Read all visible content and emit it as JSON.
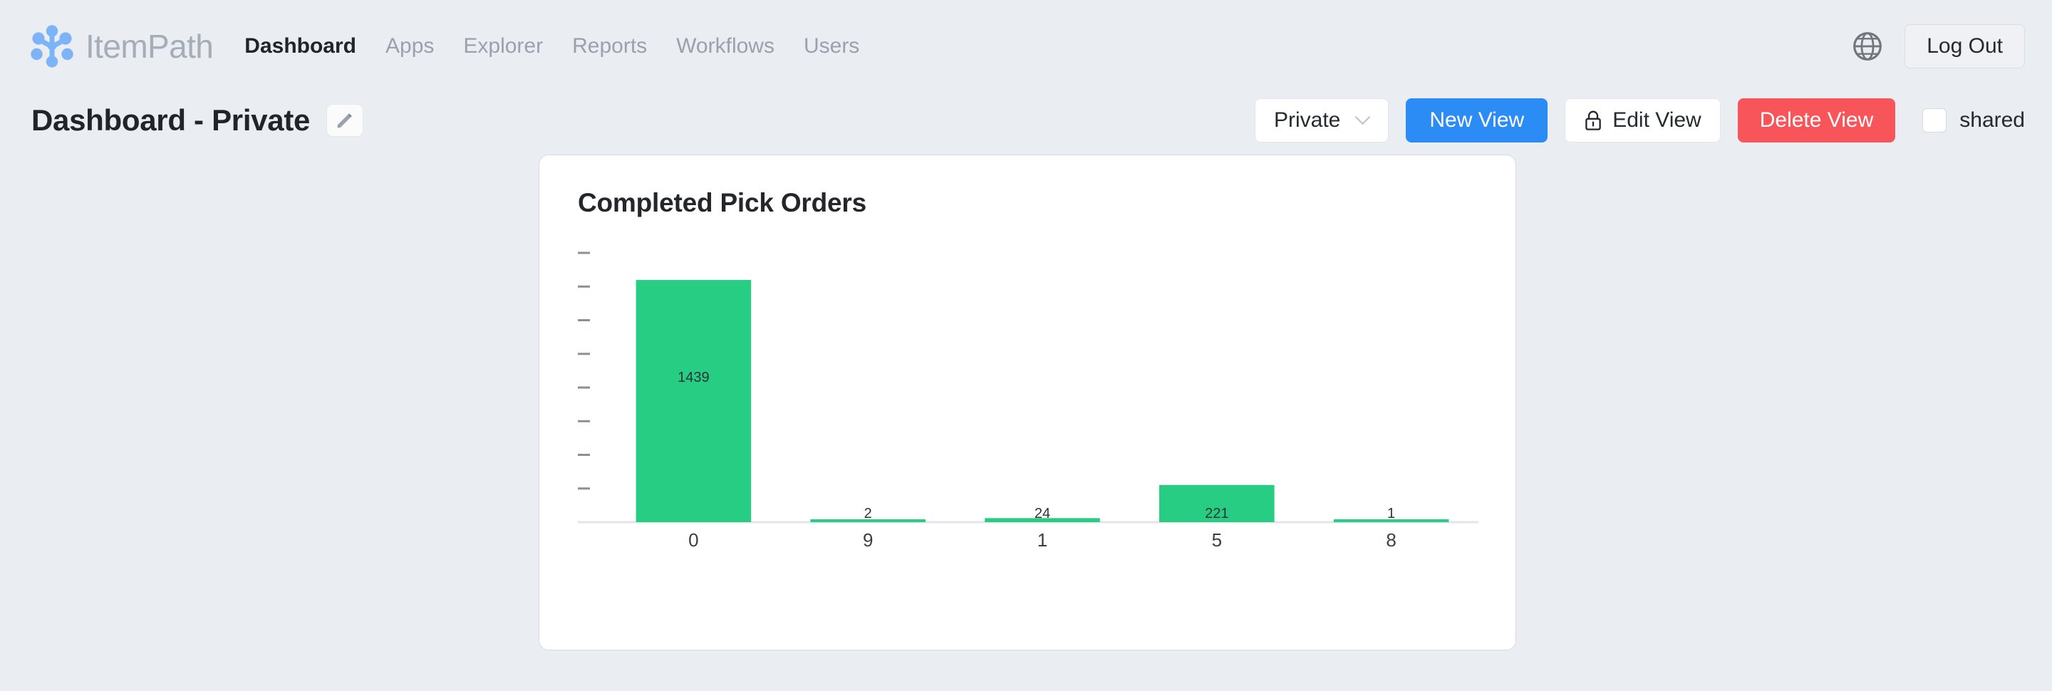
{
  "nav": {
    "brand_name": "ItemPath",
    "brand_logo_icon": "itempath-nodes-logo-icon",
    "links": [
      {
        "label": "Dashboard",
        "active": true
      },
      {
        "label": "Apps",
        "active": false
      },
      {
        "label": "Explorer",
        "active": false
      },
      {
        "label": "Reports",
        "active": false
      },
      {
        "label": "Workflows",
        "active": false
      },
      {
        "label": "Users",
        "active": false
      }
    ],
    "globe_icon": "globe-icon",
    "logout_label": "Log Out"
  },
  "titlebar": {
    "title": "Dashboard - Private",
    "edit_icon": "pencil-icon",
    "visibility_select": {
      "value": "Private",
      "chevron_icon": "chevron-down-icon"
    },
    "new_view_label": "New View",
    "edit_view_label": "Edit View",
    "edit_view_icon": "lock-icon",
    "delete_view_label": "Delete View",
    "shared_label": "shared",
    "shared_checked": false
  },
  "colors": {
    "page_background": "#eaedf2",
    "primary_blue": "#2b8cf5",
    "danger_red": "#f8555a",
    "bar_green": "#26cd83",
    "brand_blue": "#7cb4f7",
    "muted_text": "#9aa1ad"
  },
  "chart_data": {
    "type": "bar",
    "title": "Completed Pick Orders",
    "xlabel": "",
    "ylabel": "",
    "categories": [
      "0",
      "9",
      "1",
      "5",
      "8"
    ],
    "values": [
      1439,
      2,
      24,
      221,
      1
    ],
    "data_labels": [
      "1439",
      "2",
      "24",
      "221",
      "1"
    ],
    "ylim": [
      0,
      1600
    ],
    "y_tick_count": 8,
    "y_tick_labels": [],
    "grid": false,
    "legend": false,
    "bar_color": "#26cd83"
  }
}
